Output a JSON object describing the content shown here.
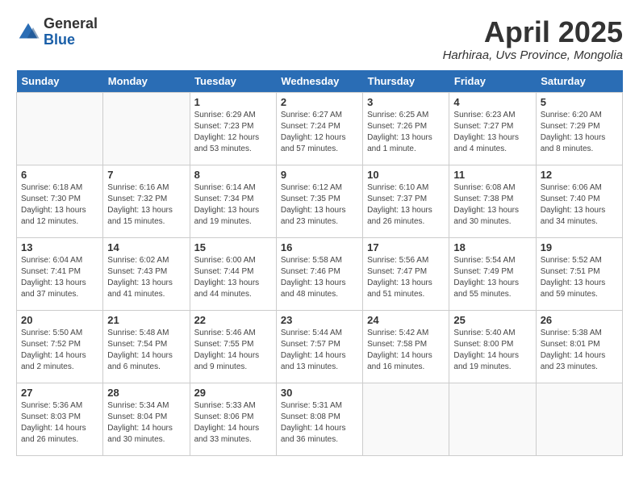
{
  "logo": {
    "general": "General",
    "blue": "Blue"
  },
  "title": "April 2025",
  "location": "Harhiraa, Uvs Province, Mongolia",
  "days_of_week": [
    "Sunday",
    "Monday",
    "Tuesday",
    "Wednesday",
    "Thursday",
    "Friday",
    "Saturday"
  ],
  "weeks": [
    [
      {
        "day": "",
        "info": ""
      },
      {
        "day": "",
        "info": ""
      },
      {
        "day": "1",
        "info": "Sunrise: 6:29 AM\nSunset: 7:23 PM\nDaylight: 12 hours and 53 minutes."
      },
      {
        "day": "2",
        "info": "Sunrise: 6:27 AM\nSunset: 7:24 PM\nDaylight: 12 hours and 57 minutes."
      },
      {
        "day": "3",
        "info": "Sunrise: 6:25 AM\nSunset: 7:26 PM\nDaylight: 13 hours and 1 minute."
      },
      {
        "day": "4",
        "info": "Sunrise: 6:23 AM\nSunset: 7:27 PM\nDaylight: 13 hours and 4 minutes."
      },
      {
        "day": "5",
        "info": "Sunrise: 6:20 AM\nSunset: 7:29 PM\nDaylight: 13 hours and 8 minutes."
      }
    ],
    [
      {
        "day": "6",
        "info": "Sunrise: 6:18 AM\nSunset: 7:30 PM\nDaylight: 13 hours and 12 minutes."
      },
      {
        "day": "7",
        "info": "Sunrise: 6:16 AM\nSunset: 7:32 PM\nDaylight: 13 hours and 15 minutes."
      },
      {
        "day": "8",
        "info": "Sunrise: 6:14 AM\nSunset: 7:34 PM\nDaylight: 13 hours and 19 minutes."
      },
      {
        "day": "9",
        "info": "Sunrise: 6:12 AM\nSunset: 7:35 PM\nDaylight: 13 hours and 23 minutes."
      },
      {
        "day": "10",
        "info": "Sunrise: 6:10 AM\nSunset: 7:37 PM\nDaylight: 13 hours and 26 minutes."
      },
      {
        "day": "11",
        "info": "Sunrise: 6:08 AM\nSunset: 7:38 PM\nDaylight: 13 hours and 30 minutes."
      },
      {
        "day": "12",
        "info": "Sunrise: 6:06 AM\nSunset: 7:40 PM\nDaylight: 13 hours and 34 minutes."
      }
    ],
    [
      {
        "day": "13",
        "info": "Sunrise: 6:04 AM\nSunset: 7:41 PM\nDaylight: 13 hours and 37 minutes."
      },
      {
        "day": "14",
        "info": "Sunrise: 6:02 AM\nSunset: 7:43 PM\nDaylight: 13 hours and 41 minutes."
      },
      {
        "day": "15",
        "info": "Sunrise: 6:00 AM\nSunset: 7:44 PM\nDaylight: 13 hours and 44 minutes."
      },
      {
        "day": "16",
        "info": "Sunrise: 5:58 AM\nSunset: 7:46 PM\nDaylight: 13 hours and 48 minutes."
      },
      {
        "day": "17",
        "info": "Sunrise: 5:56 AM\nSunset: 7:47 PM\nDaylight: 13 hours and 51 minutes."
      },
      {
        "day": "18",
        "info": "Sunrise: 5:54 AM\nSunset: 7:49 PM\nDaylight: 13 hours and 55 minutes."
      },
      {
        "day": "19",
        "info": "Sunrise: 5:52 AM\nSunset: 7:51 PM\nDaylight: 13 hours and 59 minutes."
      }
    ],
    [
      {
        "day": "20",
        "info": "Sunrise: 5:50 AM\nSunset: 7:52 PM\nDaylight: 14 hours and 2 minutes."
      },
      {
        "day": "21",
        "info": "Sunrise: 5:48 AM\nSunset: 7:54 PM\nDaylight: 14 hours and 6 minutes."
      },
      {
        "day": "22",
        "info": "Sunrise: 5:46 AM\nSunset: 7:55 PM\nDaylight: 14 hours and 9 minutes."
      },
      {
        "day": "23",
        "info": "Sunrise: 5:44 AM\nSunset: 7:57 PM\nDaylight: 14 hours and 13 minutes."
      },
      {
        "day": "24",
        "info": "Sunrise: 5:42 AM\nSunset: 7:58 PM\nDaylight: 14 hours and 16 minutes."
      },
      {
        "day": "25",
        "info": "Sunrise: 5:40 AM\nSunset: 8:00 PM\nDaylight: 14 hours and 19 minutes."
      },
      {
        "day": "26",
        "info": "Sunrise: 5:38 AM\nSunset: 8:01 PM\nDaylight: 14 hours and 23 minutes."
      }
    ],
    [
      {
        "day": "27",
        "info": "Sunrise: 5:36 AM\nSunset: 8:03 PM\nDaylight: 14 hours and 26 minutes."
      },
      {
        "day": "28",
        "info": "Sunrise: 5:34 AM\nSunset: 8:04 PM\nDaylight: 14 hours and 30 minutes."
      },
      {
        "day": "29",
        "info": "Sunrise: 5:33 AM\nSunset: 8:06 PM\nDaylight: 14 hours and 33 minutes."
      },
      {
        "day": "30",
        "info": "Sunrise: 5:31 AM\nSunset: 8:08 PM\nDaylight: 14 hours and 36 minutes."
      },
      {
        "day": "",
        "info": ""
      },
      {
        "day": "",
        "info": ""
      },
      {
        "day": "",
        "info": ""
      }
    ]
  ]
}
